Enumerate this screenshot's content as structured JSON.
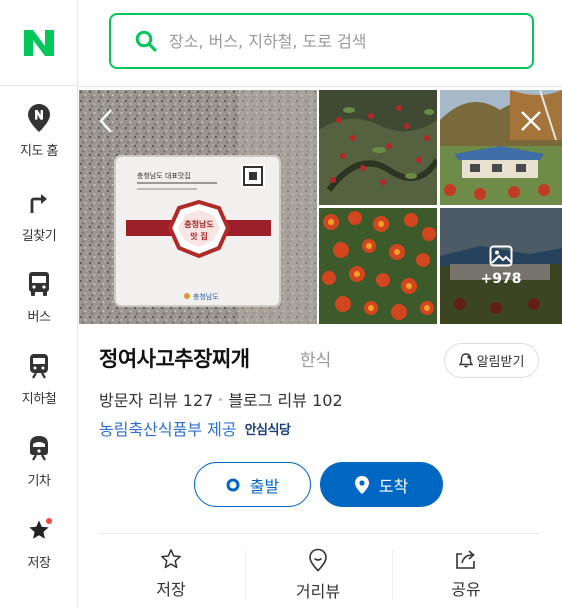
{
  "app": {
    "logo_letter": "N",
    "brand_color": "#03c75a",
    "accent_color": "#0068c3"
  },
  "search": {
    "placeholder": "장소, 버스, 지하철, 도로 검색",
    "value": ""
  },
  "sidebar": {
    "items": [
      {
        "label": "지도 홈",
        "icon": "map-pin-n-icon"
      },
      {
        "label": "길찾기",
        "icon": "directions-arrow-icon"
      },
      {
        "label": "버스",
        "icon": "bus-icon"
      },
      {
        "label": "지하철",
        "icon": "subway-icon"
      },
      {
        "label": "기차",
        "icon": "train-icon"
      },
      {
        "label": "저장",
        "icon": "star-icon",
        "has_notification_dot": true
      }
    ]
  },
  "photos": {
    "main_sign": {
      "top_text": "충청남도 대표맛집",
      "seal_line1": "충청남도",
      "seal_line2": "맛 집",
      "footer_text": "충청남도"
    },
    "more_count": "+978"
  },
  "place": {
    "name": "정여사고추장찌개",
    "category": "한식",
    "alert_label": "알림받기",
    "visitor_reviews": "방문자 리뷰 127",
    "blog_reviews": "블로그 리뷰 102",
    "provider": "농림축산식품부 제공",
    "provider_badge": "안심식당"
  },
  "route": {
    "start_label": "출발",
    "arrive_label": "도착"
  },
  "actions": [
    {
      "label": "저장",
      "icon": "star-outline-icon"
    },
    {
      "label": "거리뷰",
      "icon": "street-view-icon"
    },
    {
      "label": "공유",
      "icon": "share-icon"
    }
  ]
}
